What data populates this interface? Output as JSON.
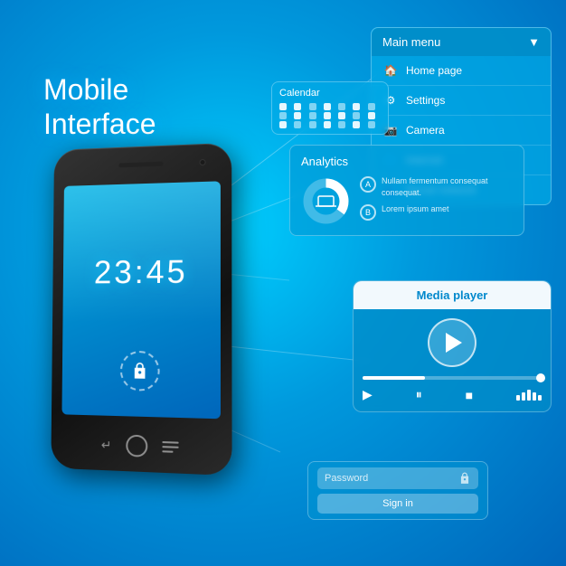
{
  "title": {
    "line1": "Mobile",
    "line2": "Interface"
  },
  "phone": {
    "time": "23:45"
  },
  "mainMenu": {
    "header": "Main menu",
    "items": [
      {
        "icon": "🏠",
        "label": "Home page"
      },
      {
        "icon": "⚙",
        "label": "Settings"
      },
      {
        "icon": "📷",
        "label": "Camera"
      },
      {
        "icon": "🌐",
        "label": "Internet"
      },
      {
        "icon": "👥",
        "label": "Social network"
      }
    ]
  },
  "calendar": {
    "label": "Calendar"
  },
  "analytics": {
    "header": "Analytics",
    "rows": [
      {
        "letter": "A",
        "text": "Nullam fermentum consequat consequat."
      },
      {
        "letter": "B",
        "text": "Lorem ipsum amet"
      }
    ]
  },
  "mediaPlayer": {
    "header": "Media player"
  },
  "signin": {
    "passwordPlaceholder": "Password",
    "signInLabel": "Sign in"
  }
}
